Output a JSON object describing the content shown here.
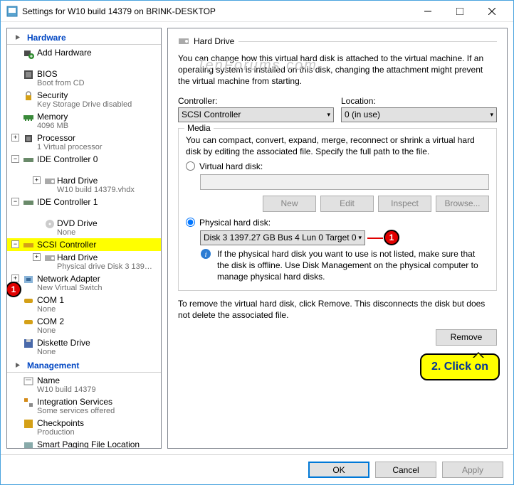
{
  "window": {
    "title": "Settings for W10 build 14379 on BRINK-DESKTOP"
  },
  "watermark": "TenForums.com",
  "sections": {
    "hardware": {
      "title": "Hardware",
      "items": [
        {
          "label": "Add Hardware",
          "sub": ""
        },
        {
          "label": "BIOS",
          "sub": "Boot from CD"
        },
        {
          "label": "Security",
          "sub": "Key Storage Drive disabled"
        },
        {
          "label": "Memory",
          "sub": "4096 MB"
        },
        {
          "label": "Processor",
          "sub": "1 Virtual processor"
        },
        {
          "label": "IDE Controller 0",
          "sub": ""
        },
        {
          "label": "Hard Drive",
          "sub": "W10 build 14379.vhdx"
        },
        {
          "label": "IDE Controller 1",
          "sub": ""
        },
        {
          "label": "DVD Drive",
          "sub": "None"
        },
        {
          "label": "SCSI Controller",
          "sub": ""
        },
        {
          "label": "Hard Drive",
          "sub": "Physical drive Disk 3 1397...."
        },
        {
          "label": "Network Adapter",
          "sub": "New Virtual Switch"
        },
        {
          "label": "COM 1",
          "sub": "None"
        },
        {
          "label": "COM 2",
          "sub": "None"
        },
        {
          "label": "Diskette Drive",
          "sub": "None"
        }
      ]
    },
    "management": {
      "title": "Management",
      "items": [
        {
          "label": "Name",
          "sub": "W10 build 14379"
        },
        {
          "label": "Integration Services",
          "sub": "Some services offered"
        },
        {
          "label": "Checkpoints",
          "sub": "Production"
        },
        {
          "label": "Smart Paging File Location",
          "sub": ""
        }
      ]
    }
  },
  "right": {
    "title": "Hard Drive",
    "desc": "You can change how this virtual hard disk is attached to the virtual machine. If an operating system is installed on this disk, changing the attachment might prevent the virtual machine from starting.",
    "controller_label": "Controller:",
    "controller_value": "SCSI Controller",
    "location_label": "Location:",
    "location_value": "0 (in use)",
    "media": {
      "legend": "Media",
      "desc": "You can compact, convert, expand, merge, reconnect or shrink a virtual hard disk by editing the associated file. Specify the full path to the file.",
      "vhd_label": "Virtual hard disk:",
      "new": "New",
      "edit": "Edit",
      "inspect": "Inspect",
      "browse": "Browse...",
      "phys_label": "Physical hard disk:",
      "phys_value": "Disk 3 1397.27 GB Bus 4 Lun 0 Target 0",
      "info": "If the physical hard disk you want to use is not listed, make sure that the disk is offline. Use Disk Management on the physical computer to manage physical hard disks."
    },
    "remove_desc": "To remove the virtual hard disk, click Remove. This disconnects the disk but does not delete the associated file.",
    "remove": "Remove"
  },
  "footer": {
    "ok": "OK",
    "cancel": "Cancel",
    "apply": "Apply"
  },
  "annotations": {
    "badge1": "1",
    "callout": "2. Click on"
  }
}
